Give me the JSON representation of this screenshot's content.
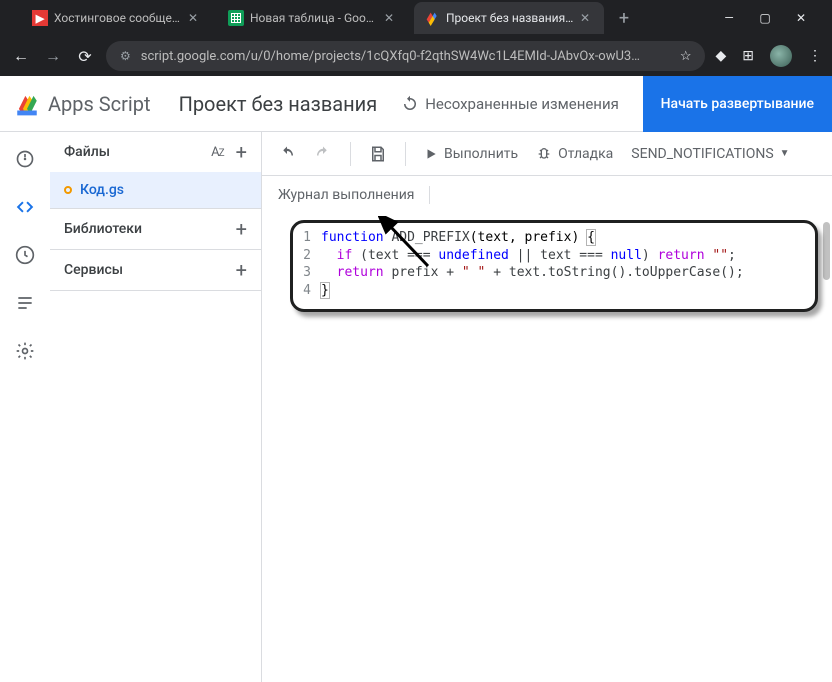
{
  "browser": {
    "tabs": [
      {
        "label": "Хостинговое сообщество"
      },
      {
        "label": "Новая таблица - Google Т"
      },
      {
        "label": "Проект без названия - Ре"
      }
    ],
    "url": "script.google.com/u/0/home/projects/1cQXfq0-f2qthSW4Wc1L4EMId-JAbvOx-owU3…"
  },
  "app": {
    "brand": "Apps Script",
    "project_title": "Проект без названия",
    "unsaved_label": "Несохраненные изменения",
    "deploy_label": "Начать развертывание"
  },
  "panel": {
    "files_label": "Файлы",
    "file_name": "Код.gs",
    "libraries_label": "Библиотеки",
    "services_label": "Сервисы"
  },
  "toolbar": {
    "run_label": "Выполнить",
    "debug_label": "Отладка",
    "function_name": "SEND_NOTIFICATIONS",
    "log_label": "Журнал выполнения"
  },
  "code": {
    "lines": {
      "l1_kw": "function",
      "l1_fn": " ADD_PREFIX",
      "l1_pr": "(text, prefix) ",
      "l1_br": "{",
      "l2_if": "if",
      "l2_cond_a": " (text === ",
      "l2_undef": "undefined",
      "l2_cond_b": " || text === ",
      "l2_null": "null",
      "l2_cond_c": ") ",
      "l2_ret": "return",
      "l2_emp": " \"\"",
      "l2_semi": ";",
      "l3_ret": "return",
      "l3_a": " prefix + ",
      "l3_sp": "\" \"",
      "l3_b": " + text.toString().toUpperCase();",
      "l4_br": "}"
    },
    "nums": {
      "n1": "1",
      "n2": "2",
      "n3": "3",
      "n4": "4"
    }
  }
}
